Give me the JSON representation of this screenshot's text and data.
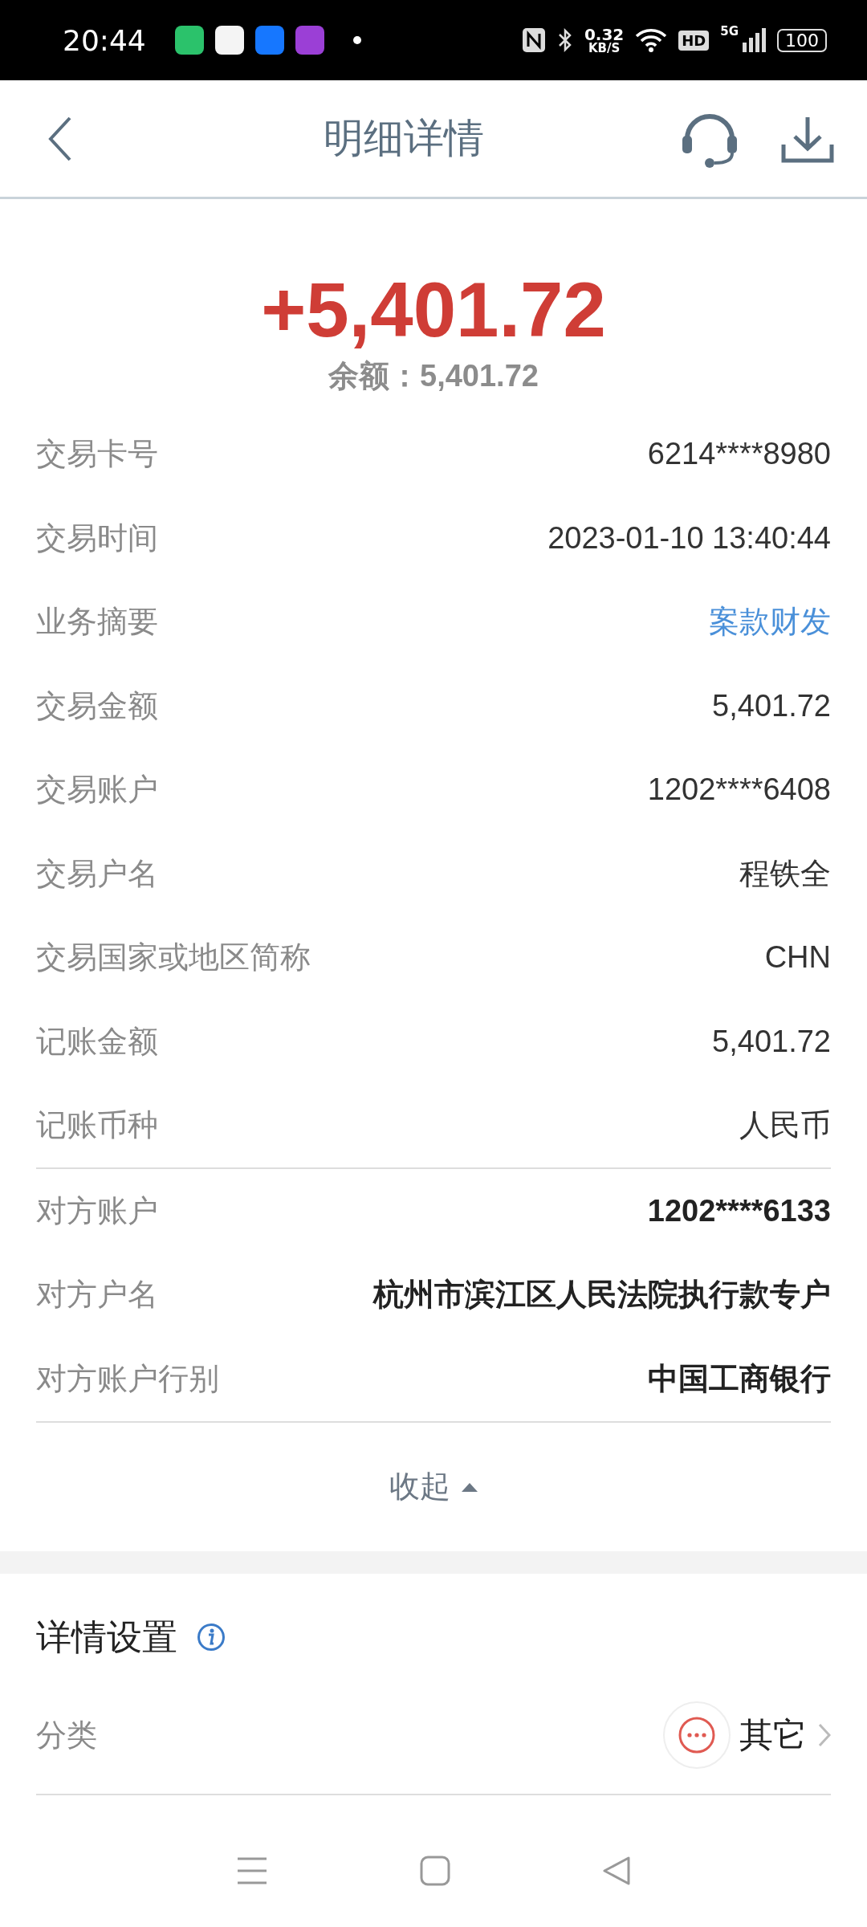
{
  "status_bar": {
    "time": "20:44",
    "net_speed": "0.32",
    "net_unit": "KB/S",
    "hd": "HD",
    "signal_label": "5G",
    "battery": "100"
  },
  "header": {
    "title": "明细详情"
  },
  "summary": {
    "amount": "+5,401.72",
    "balance_label": "余额：",
    "balance": "5,401.72"
  },
  "detail_rows": [
    {
      "label": "交易卡号",
      "value": "6214****8980",
      "kind": "plain"
    },
    {
      "label": "交易时间",
      "value": "2023-01-10 13:40:44",
      "kind": "plain"
    },
    {
      "label": "业务摘要",
      "value": "案款财发",
      "kind": "link"
    },
    {
      "label": "交易金额",
      "value": "5,401.72",
      "kind": "plain"
    },
    {
      "label": "交易账户",
      "value": "1202****6408",
      "kind": "plain"
    },
    {
      "label": "交易户名",
      "value": "程铁全",
      "kind": "plain"
    },
    {
      "label": "交易国家或地区简称",
      "value": "CHN",
      "kind": "plain"
    },
    {
      "label": "记账金额",
      "value": "5,401.72",
      "kind": "plain"
    },
    {
      "label": "记账币种",
      "value": "人民币",
      "kind": "plain"
    }
  ],
  "counterparty_rows": [
    {
      "label": "对方账户",
      "value": "1202****6133",
      "kind": "bold"
    },
    {
      "label": "对方户名",
      "value": "杭州市滨江区人民法院执行款专户",
      "kind": "bold"
    },
    {
      "label": "对方账户行别",
      "value": "中国工商银行",
      "kind": "bold"
    }
  ],
  "collapse": {
    "label": "收起",
    "expanded": true
  },
  "settings": {
    "title": "详情设置",
    "category_label": "分类",
    "category_value": "其它"
  }
}
